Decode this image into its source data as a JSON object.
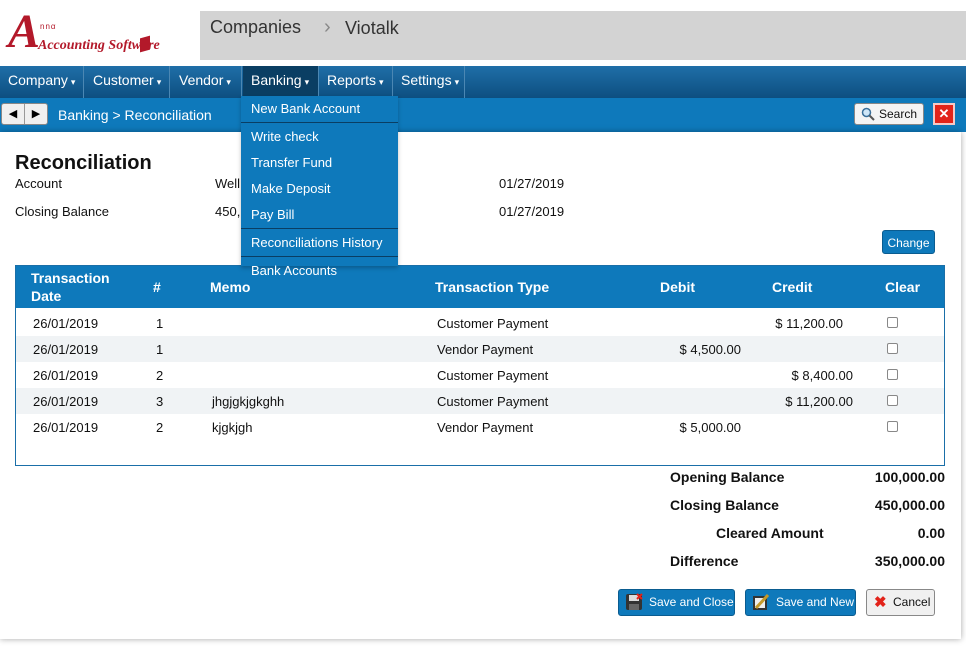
{
  "app": {
    "logo_text": "Accounting Software",
    "logo_letter": "A",
    "logo_small": "nnα"
  },
  "header": {
    "crumb1": "Companies",
    "crumb2": "Viotalk"
  },
  "menu": [
    {
      "label": "Company"
    },
    {
      "label": "Customer"
    },
    {
      "label": "Vendor"
    },
    {
      "label": "Banking"
    },
    {
      "label": "Reports"
    },
    {
      "label": "Settings"
    }
  ],
  "crumbbar": {
    "text": "Banking > Reconciliation",
    "search_label": "Search",
    "close_label": "✕"
  },
  "dropdown": {
    "items": [
      "New Bank Account",
      "Write check",
      "Transfer Fund",
      "Make Deposit",
      "Pay Bill",
      "Reconciliations History",
      "Bank Accounts"
    ]
  },
  "form": {
    "title": "Reconciliation",
    "account_label": "Account",
    "account_value": "Well",
    "account_date": "01/27/2019",
    "closing_label": "Closing Balance",
    "closing_value": "450,",
    "closing_date": "01/27/2019",
    "change_label": "Change"
  },
  "table": {
    "headers": [
      "Transaction",
      "Date",
      "#",
      "Memo",
      "Transaction Type",
      "Debit",
      "Credit",
      "Clear"
    ],
    "rows": [
      {
        "date": "26/01/2019",
        "num": "1",
        "memo": "",
        "type": "Customer Payment",
        "debit": "",
        "credit": "$ 11,200.00"
      },
      {
        "date": "26/01/2019",
        "num": "1",
        "memo": "",
        "type": "Vendor Payment",
        "debit": "$ 4,500.00",
        "credit": ""
      },
      {
        "date": "26/01/2019",
        "num": "2",
        "memo": "",
        "type": "Customer Payment",
        "debit": "",
        "credit": "$ 8,400.00"
      },
      {
        "date": "26/01/2019",
        "num": "3",
        "memo": "jhgjgkjgkghh",
        "type": "Customer Payment",
        "debit": "",
        "credit": "$ 11,200.00"
      },
      {
        "date": "26/01/2019",
        "num": "2",
        "memo": "kjgkjgh",
        "type": "Vendor Payment",
        "debit": "$ 5,000.00",
        "credit": ""
      }
    ]
  },
  "summary": {
    "opening_label": "Opening Balance",
    "opening_value": "100,000.00",
    "closing_label": "Closing Balance",
    "closing_value": "450,000.00",
    "cleared_label": "Cleared Amount",
    "cleared_value": "0.00",
    "difference_label": "Difference",
    "difference_value": "350,000.00"
  },
  "buttons": {
    "save_close": "Save and Close",
    "save_new": "Save and New",
    "cancel": "Cancel"
  },
  "colors": {
    "primary": "#0e79bb",
    "logo": "#b3192a",
    "close": "#e2231a"
  }
}
